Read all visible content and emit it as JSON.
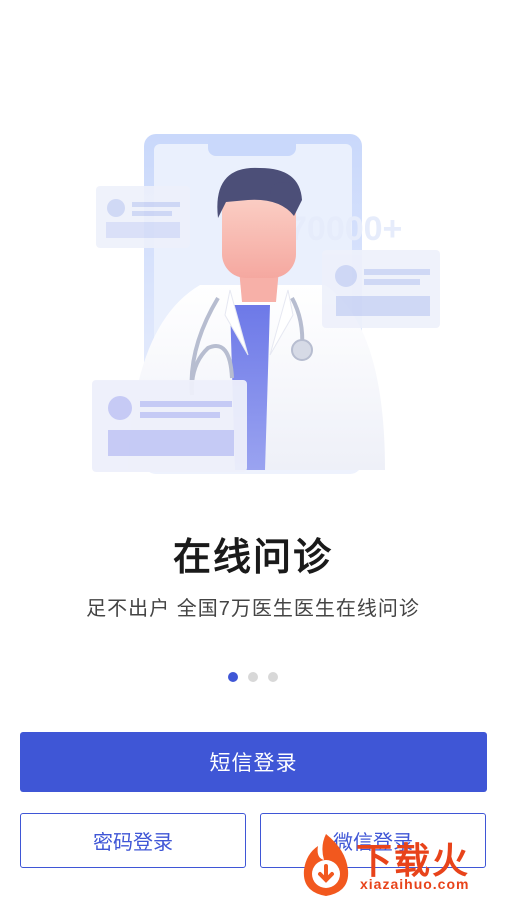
{
  "onboarding": {
    "title": "在线问诊",
    "subtitle": "足不出户 全国7万医生医生在线问诊",
    "illustration_badge": "70000+",
    "pager": {
      "count": 3,
      "active": 0
    }
  },
  "actions": {
    "sms_login": "短信登录",
    "password_login": "密码登录",
    "wechat_login": "微信登录"
  },
  "watermark": {
    "brand": "下载火",
    "url": "xiazaihuo.com"
  },
  "colors": {
    "accent": "#3f56d6",
    "watermark": "#e8431a"
  },
  "icons": {
    "illustration": "doctor-illustration",
    "watermark_logo": "flame-logo-icon"
  }
}
